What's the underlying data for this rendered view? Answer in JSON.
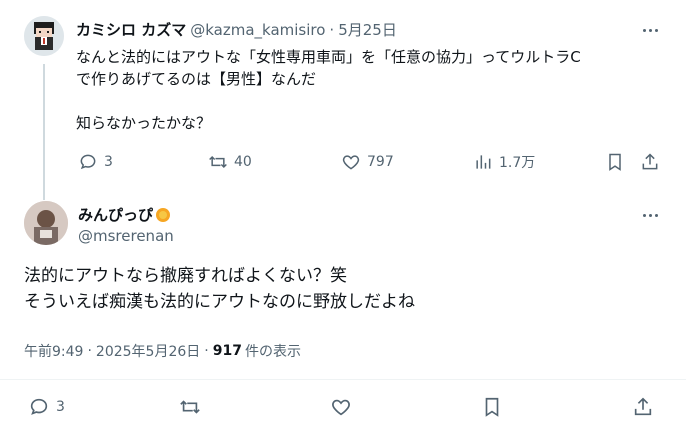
{
  "colors": {
    "text": "#0f1419",
    "muted": "#536471",
    "divider": "#eff3f4",
    "thread": "#cfd9de"
  },
  "parent_tweet": {
    "display_name": "カミシロ カズマ",
    "handle": "@kazma_kamisiro",
    "sep": "·",
    "date": "5月25日",
    "text_line1": "なんと法的にはアウトな「女性専用車両」を「任意の協力」ってウルトラC",
    "text_line2": "で作りあげてるのは【男性】なんだ",
    "text_line4": "知らなかったかな？",
    "actions": {
      "reply_count": "3",
      "retweet_count": "40",
      "like_count": "797",
      "views_count": "1.7万"
    }
  },
  "main_tweet": {
    "display_name": "みんぴっぴ",
    "badge_icon": "sun-flower-emoji",
    "handle": "@msrerenan",
    "text_line1": "法的にアウトなら撤廃すればよくない？笑",
    "text_line2": "そういえば痴漢も法的にアウトなのに野放しだよね",
    "time": "午前9:49",
    "dot": "·",
    "date": "2025年5月26日",
    "views_number": "917",
    "views_label": "件の表示",
    "actions": {
      "reply_count": "3"
    }
  }
}
